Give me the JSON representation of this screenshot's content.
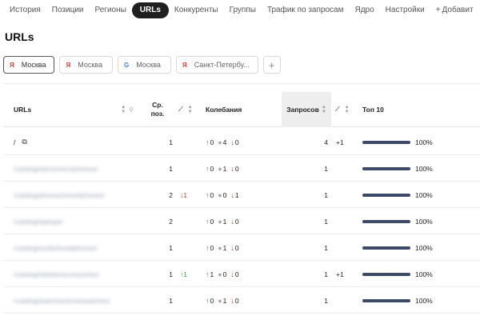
{
  "nav": {
    "items": [
      {
        "label": "История",
        "active": false
      },
      {
        "label": "Позиции",
        "active": false
      },
      {
        "label": "Регионы",
        "active": false
      },
      {
        "label": "URLs",
        "active": true
      },
      {
        "label": "Конкуренты",
        "active": false
      },
      {
        "label": "Группы",
        "active": false
      },
      {
        "label": "Трафик по запросам",
        "active": false
      },
      {
        "label": "Ядро",
        "active": false
      },
      {
        "label": "Настройки",
        "active": false
      }
    ],
    "add_label": "Добавит"
  },
  "page": {
    "title": "URLs"
  },
  "regions": [
    {
      "engine": "Я",
      "engine_color": "#e23b2e",
      "label": "Москва",
      "active": true
    },
    {
      "engine": "Я",
      "engine_color": "#e23b2e",
      "label": "Москва",
      "active": false
    },
    {
      "engine": "G",
      "engine_color": "#4285f4",
      "label": "Москва",
      "active": false
    },
    {
      "engine": "Я",
      "engine_color": "#e23b2e",
      "label": "Санкт-Петербу...",
      "active": false
    }
  ],
  "regions_add": "+",
  "table": {
    "headers": {
      "urls": "URLs",
      "avg_pos_line1": "Ср.",
      "avg_pos_line2": "поз.",
      "fluctuations": "Колебания",
      "queries": "Запросов",
      "top10": "Топ 10"
    },
    "rows": [
      {
        "url": "/",
        "blurred": false,
        "avg": "1",
        "delta": "",
        "up": "0",
        "same": "4",
        "down": "0",
        "queries": "4",
        "qdelta": "+1",
        "top10": "100%"
      },
      {
        "url": "/catalog/electronics/phones/",
        "blurred": true,
        "avg": "1",
        "delta": "",
        "up": "0",
        "same": "1",
        "down": "0",
        "queries": "1",
        "qdelta": "",
        "top10": "100%"
      },
      {
        "url": "/catalog/phones/smartphones/",
        "blurred": true,
        "avg": "2",
        "delta": "1",
        "up": "0",
        "same": "0",
        "down": "1",
        "queries": "1",
        "qdelta": "",
        "top10": "100%"
      },
      {
        "url": "/catalog/laptops/",
        "blurred": true,
        "avg": "2",
        "delta": "",
        "up": "0",
        "same": "1",
        "down": "0",
        "queries": "1",
        "qdelta": "",
        "top10": "100%"
      },
      {
        "url": "/catalog/audio/headphones/",
        "blurred": true,
        "avg": "1",
        "delta": "",
        "up": "0",
        "same": "1",
        "down": "0",
        "queries": "1",
        "qdelta": "",
        "top10": "100%"
      },
      {
        "url": "/catalog/tablets/accessories/",
        "blurred": true,
        "avg": "1",
        "delta": "1",
        "up": "1",
        "same": "0",
        "down": "0",
        "queries": "1",
        "qdelta": "+1",
        "top10": "100%"
      },
      {
        "url": "/catalog/watches/smartwatches/",
        "blurred": true,
        "avg": "1",
        "delta": "",
        "up": "0",
        "same": "1",
        "down": "0",
        "queries": "1",
        "qdelta": "",
        "top10": "100%"
      }
    ]
  },
  "icons": {
    "sort": "sort-arrows-icon",
    "search": "search-icon",
    "chart": "trend-chart-icon",
    "external": "external-link-icon",
    "arrow_up": "arrow-up-icon",
    "arrow_down": "arrow-down-icon"
  },
  "colors": {
    "up": "#2e9c3c",
    "down": "#c0392b",
    "bar": "#3c4a67",
    "active_tab": "#1f1f1f"
  }
}
